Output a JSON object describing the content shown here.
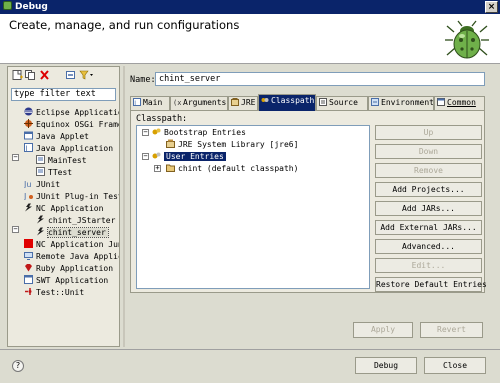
{
  "window": {
    "title": "Debug",
    "close_label": "×"
  },
  "banner": {
    "title": "Create, manage, and run configurations"
  },
  "filter": {
    "value": "type filter text"
  },
  "tree": {
    "items": [
      {
        "label": "Eclipse Applicatio",
        "icon": "eclipse-icon"
      },
      {
        "label": "Equinox OSGi Frame",
        "icon": "osgi-icon"
      },
      {
        "label": "Java Applet",
        "icon": "applet-icon"
      },
      {
        "label": "Java Application",
        "icon": "java-app-icon"
      },
      {
        "label": "MainTest",
        "icon": "java-config-icon"
      },
      {
        "label": "TTest",
        "icon": "java-config-icon"
      },
      {
        "label": "JUnit",
        "icon": "junit-icon"
      },
      {
        "label": "JUnit Plug-in Test",
        "icon": "junit-plugin-icon"
      },
      {
        "label": "NC Application",
        "icon": "nc-app-icon"
      },
      {
        "label": "chint_JStarter",
        "icon": "nc-config-icon"
      },
      {
        "label": "chint_server",
        "icon": "nc-config-icon"
      },
      {
        "label": "NC Application Jun",
        "icon": "nc-junit-icon"
      },
      {
        "label": "Remote Java Applic",
        "icon": "remote-icon"
      },
      {
        "label": "Ruby Application",
        "icon": "ruby-icon"
      },
      {
        "label": "SWT Application",
        "icon": "swt-icon"
      },
      {
        "label": "Test::Unit",
        "icon": "testunit-icon"
      }
    ]
  },
  "config": {
    "name_label": "Name:",
    "name_value": "chint_server"
  },
  "tabs": [
    "Main",
    "Arguments",
    "JRE",
    "Classpath",
    "Source",
    "Environment",
    "Common"
  ],
  "classpath": {
    "label": "Classpath:",
    "entries": [
      {
        "label": "Bootstrap Entries"
      },
      {
        "label": "JRE System Library [jre6]"
      },
      {
        "label": "User Entries"
      },
      {
        "label": "chint (default classpath)"
      }
    ]
  },
  "classpath_buttons": [
    "Up",
    "Down",
    "Remove",
    "Add Projects...",
    "Add JARs...",
    "Add External JARs...",
    "Advanced...",
    "Edit...",
    "Restore Default Entries"
  ],
  "apply_label": "Apply",
  "revert_label": "Revert",
  "debug_label": "Debug",
  "close_label": "Close",
  "help_label": "?"
}
